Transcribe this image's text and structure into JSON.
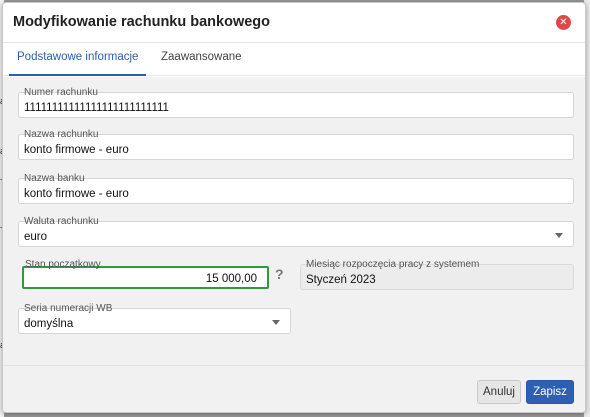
{
  "dialog": {
    "title": "Modyfikowanie rachunku bankowego",
    "close_icon": "close-circle-icon"
  },
  "tabs": [
    {
      "label": "Podstawowe informacje",
      "active": true
    },
    {
      "label": "Zaawansowane",
      "active": false
    }
  ],
  "form": {
    "account_number": {
      "label": "Numer rachunku",
      "value": "11111111111111111111111111"
    },
    "account_name": {
      "label": "Nazwa rachunku",
      "value": "konto firmowe - euro"
    },
    "bank_name": {
      "label": "Nazwa banku",
      "value": "konto firmowe - euro"
    },
    "currency": {
      "label": "Waluta rachunku",
      "value": "euro"
    },
    "opening_balance": {
      "label": "Stan początkowy",
      "value": "15 000,00",
      "help": "?"
    },
    "start_month": {
      "label": "Miesiąc rozpoczęcia pracy z systemem",
      "value": "Styczeń 2023"
    },
    "numbering_series": {
      "label": "Seria numeracji WB",
      "value": "domyślna"
    }
  },
  "footer": {
    "cancel_label": "Anuluj",
    "save_label": "Zapisz"
  },
  "background": {
    "edge_letters": [
      "a",
      "a",
      "-",
      "-",
      "a"
    ]
  },
  "colors": {
    "accent": "#2c5fa8",
    "save_button": "#2f5fb3",
    "highlight_border": "#2e9a3a",
    "close_icon": "#e04848"
  }
}
